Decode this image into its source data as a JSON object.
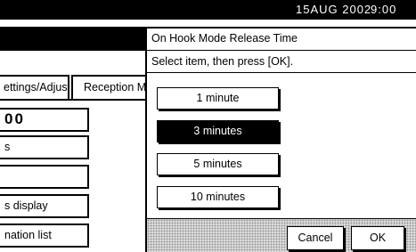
{
  "status_bar": {
    "date": "15AUG  2002",
    "time": "9:00"
  },
  "background": {
    "tabs": [
      {
        "label": "ettings/Adjust"
      },
      {
        "label": "Reception M"
      }
    ],
    "items": [
      {
        "label": "00"
      },
      {
        "label": "s"
      },
      {
        "label": ""
      },
      {
        "label": "s display"
      },
      {
        "label": "nation list"
      }
    ]
  },
  "dialog": {
    "title": "On Hook Mode Release Time",
    "instruction": "Select item, then press [OK].",
    "options": [
      {
        "label": "1 minute",
        "selected": false
      },
      {
        "label": "3 minutes",
        "selected": true
      },
      {
        "label": "5 minutes",
        "selected": false
      },
      {
        "label": "10 minutes",
        "selected": false
      }
    ],
    "cancel_label": "Cancel",
    "ok_label": "OK"
  }
}
